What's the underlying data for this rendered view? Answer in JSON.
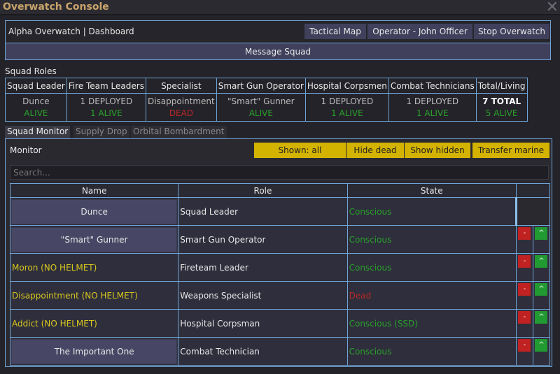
{
  "window": {
    "title": "Overwatch Console",
    "close_icon": "close-icon"
  },
  "header": {
    "title": "Alpha Overwatch | Dashboard",
    "tactical_map": "Tactical Map",
    "operator": "Operator - John Officer",
    "stop": "Stop Overwatch",
    "message_squad": "Message Squad"
  },
  "roles": {
    "label": "Squad Roles",
    "columns": [
      {
        "head": "Squad Leader",
        "line1": "Dunce",
        "line2": "ALIVE",
        "status": "alive"
      },
      {
        "head": "Fire Team Leaders",
        "line1": "1 DEPLOYED",
        "line2": "1 ALIVE",
        "status": "alive"
      },
      {
        "head": "Specialist",
        "line1": "Disappointment",
        "line2": "DEAD",
        "status": "dead"
      },
      {
        "head": "Smart Gun Operator",
        "line1": "\"Smart\" Gunner",
        "line2": "ALIVE",
        "status": "alive"
      },
      {
        "head": "Hospital Corpsmen",
        "line1": "1 DEPLOYED",
        "line2": "1 ALIVE",
        "status": "alive"
      },
      {
        "head": "Combat Technicians",
        "line1": "1 DEPLOYED",
        "line2": "1 ALIVE",
        "status": "alive"
      },
      {
        "head": "Total/Living",
        "line1": "7 TOTAL",
        "line2": "5 ALIVE",
        "status": "alive"
      }
    ]
  },
  "tabs": [
    "Squad Monitor",
    "Supply Drop",
    "Orbital Bombardment"
  ],
  "monitor": {
    "label": "Monitor",
    "shown_all": "Shown: all",
    "hide_dead": "Hide dead",
    "show_hidden": "Show hidden",
    "transfer": "Transfer marine",
    "search_placeholder": "Search...",
    "headers": [
      "Name",
      "Role",
      "State"
    ],
    "rows": [
      {
        "name": "Dunce",
        "role": "Squad Leader",
        "state": "Conscious",
        "button": true,
        "warn": false,
        "dead": false,
        "actions": false
      },
      {
        "name": "\"Smart\" Gunner",
        "role": "Smart Gun Operator",
        "state": "Conscious",
        "button": true,
        "warn": false,
        "dead": false,
        "actions": true
      },
      {
        "name": "Moron (NO HELMET)",
        "role": "Fireteam Leader",
        "state": "Conscious",
        "button": false,
        "warn": true,
        "dead": false,
        "actions": true
      },
      {
        "name": "Disappointment (NO HELMET)",
        "role": "Weapons Specialist",
        "state": "Dead",
        "button": false,
        "warn": true,
        "dead": true,
        "actions": true
      },
      {
        "name": "Addict (NO HELMET)",
        "role": "Hospital Corpsman",
        "state": "Conscious (SSD)",
        "button": false,
        "warn": true,
        "dead": false,
        "actions": true
      },
      {
        "name": "The Important One",
        "role": "Combat Technician",
        "state": "Conscious",
        "button": true,
        "warn": false,
        "dead": false,
        "actions": true
      }
    ],
    "demote": "-",
    "promote": "^"
  },
  "colors": {
    "alive": "#2aa02a",
    "dead": "#b82828",
    "accent": "#d4b300",
    "border": "#6fa4d6"
  }
}
